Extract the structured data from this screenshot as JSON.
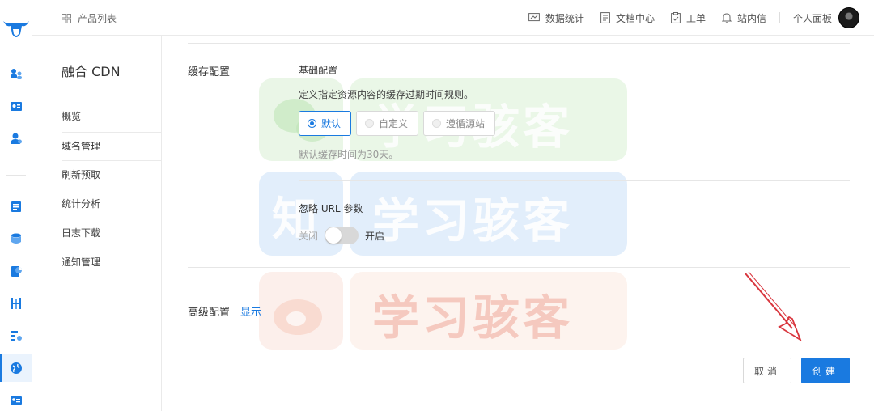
{
  "header": {
    "product_list": "产品列表",
    "nav": [
      {
        "label": "数据统计",
        "icon": "monitor-chart-icon"
      },
      {
        "label": "文档中心",
        "icon": "document-icon"
      },
      {
        "label": "工单",
        "icon": "clipboard-icon"
      },
      {
        "label": "站内信",
        "icon": "bell-icon"
      }
    ],
    "user_panel": "个人面板"
  },
  "rail": {
    "icons": [
      "users-icon",
      "id-card-icon",
      "user-settings-icon",
      "list-icon",
      "database-icon",
      "pie-report-icon",
      "network-icon",
      "settings-list-icon",
      "globe-icon",
      "user-card-icon"
    ],
    "active": "globe-icon"
  },
  "sidebar": {
    "title": "融合 CDN",
    "items": [
      {
        "label": "概览"
      },
      {
        "label": "域名管理",
        "selected": true
      },
      {
        "label": "刷新预取"
      },
      {
        "label": "统计分析"
      },
      {
        "label": "日志下载"
      },
      {
        "label": "通知管理"
      }
    ]
  },
  "form": {
    "cache": {
      "section_label": "缓存配置",
      "basic_label": "基础配置",
      "description": "定义指定资源内容的缓存过期时间规则。",
      "options": [
        {
          "label": "默认",
          "checked": true
        },
        {
          "label": "自定义",
          "checked": false
        },
        {
          "label": "遵循源站",
          "checked": false
        }
      ],
      "hint": "默认缓存时间为30天。"
    },
    "ignore_params": {
      "label": "忽略 URL 参数",
      "off_label": "关闭",
      "on_label": "开启",
      "enabled": false
    },
    "advanced": {
      "label": "高级配置",
      "toggle_link": "显示"
    },
    "actions": {
      "cancel": "取消",
      "create": "创建"
    }
  },
  "watermark": {
    "text": "学习骇客",
    "badges": [
      "wechat-logo-icon",
      "zhihu-logo-icon",
      "weibo-logo-icon"
    ],
    "zhihu_char": "知"
  },
  "colors": {
    "primary": "#1a7ae0",
    "annotation_arrow": "#d9363e"
  }
}
